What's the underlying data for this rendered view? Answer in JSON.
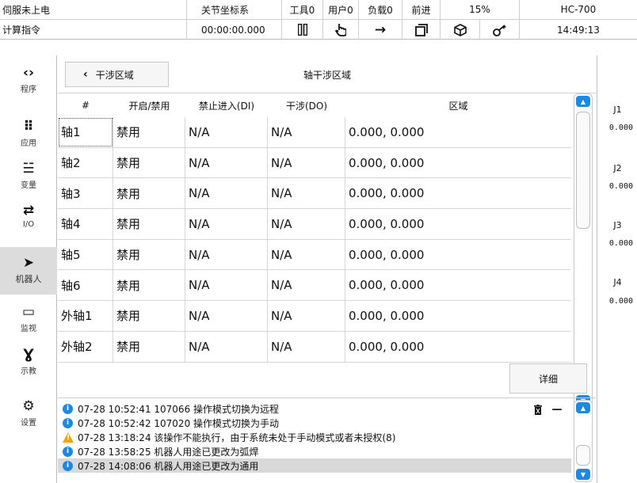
{
  "status": {
    "servo": "伺服未上电",
    "coord": "关节坐标系",
    "tool": "工具0",
    "user": "用户0",
    "load": "负载0",
    "direction": "前进",
    "speed": "15%",
    "model": "HC-700",
    "mode": "计算指令",
    "run_time": "00:00:00.000",
    "clock": "14:49:13"
  },
  "icons": {
    "pause": "pause-icon",
    "hand": "hand-pointer-icon",
    "arrow": "arrow-right-icon",
    "frame": "frame-icon",
    "cube": "cube-icon",
    "key": "key-icon"
  },
  "nav": [
    {
      "label": "程序",
      "icon": "code-icon"
    },
    {
      "label": "应用",
      "icon": "grid-icon"
    },
    {
      "label": "变量",
      "icon": "sliders-icon"
    },
    {
      "label": "I/O",
      "icon": "io-icon"
    },
    {
      "label": "机器人",
      "icon": "robot-icon"
    },
    {
      "label": "监视",
      "icon": "monitor-icon"
    },
    {
      "label": "示教",
      "icon": "teach-icon"
    },
    {
      "label": "设置",
      "icon": "gear-icon"
    }
  ],
  "page": {
    "back_label": "干涉区域",
    "title": "轴干涉区域",
    "detail_label": "详细"
  },
  "table": {
    "columns": [
      "#",
      "开启/禁用",
      "禁止进入(DI)",
      "干涉(DO)",
      "区域"
    ],
    "rows": [
      [
        "轴1",
        "禁用",
        "N/A",
        "N/A",
        "0.000, 0.000"
      ],
      [
        "轴2",
        "禁用",
        "N/A",
        "N/A",
        "0.000, 0.000"
      ],
      [
        "轴3",
        "禁用",
        "N/A",
        "N/A",
        "0.000, 0.000"
      ],
      [
        "轴4",
        "禁用",
        "N/A",
        "N/A",
        "0.000, 0.000"
      ],
      [
        "轴5",
        "禁用",
        "N/A",
        "N/A",
        "0.000, 0.000"
      ],
      [
        "轴6",
        "禁用",
        "N/A",
        "N/A",
        "0.000, 0.000"
      ],
      [
        "外轴1",
        "禁用",
        "N/A",
        "N/A",
        "0.000, 0.000"
      ],
      [
        "外轴2",
        "禁用",
        "N/A",
        "N/A",
        "0.000, 0.000"
      ]
    ]
  },
  "log": [
    {
      "level": "info",
      "text": "07-28 10:52:41 107066 操作模式切换为远程"
    },
    {
      "level": "info",
      "text": "07-28 10:52:42 107020 操作模式切换为手动"
    },
    {
      "level": "warn",
      "text": "07-28 13:18:24 该操作不能执行，由于系统未处于手动模式或者未授权(8)"
    },
    {
      "level": "info",
      "text": "07-28 13:58:25 机器人用途已更改为弧焊"
    },
    {
      "level": "info",
      "text": "07-28 14:08:06 机器人用途已更改为通用"
    }
  ],
  "joints": [
    {
      "label": "J1",
      "value": "0.000"
    },
    {
      "label": "J2",
      "value": "0.000"
    },
    {
      "label": "J3",
      "value": "0.000"
    },
    {
      "label": "J4",
      "value": "0.000"
    }
  ],
  "colors": {
    "accent": "#1e88e5",
    "warning": "#f0a500",
    "selected": "#dcdcdc"
  }
}
